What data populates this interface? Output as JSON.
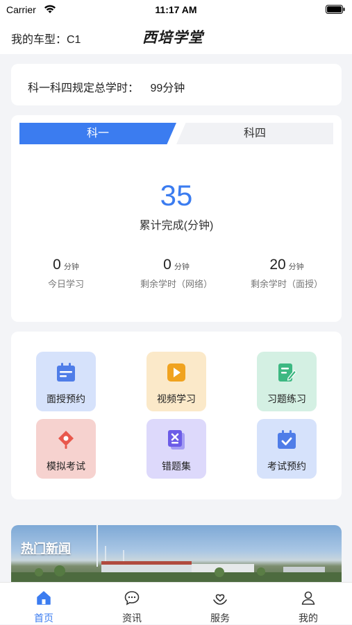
{
  "status_bar": {
    "carrier": "Carrier",
    "time": "11:17 AM"
  },
  "header": {
    "car_type": "我的车型：C1",
    "brand": "西培学堂"
  },
  "required_hours": {
    "label": "科一科四规定总学时：",
    "value": "99分钟"
  },
  "progress": {
    "tabs": [
      {
        "label": "科一",
        "active": true
      },
      {
        "label": "科四",
        "active": false
      }
    ],
    "total_value": "35",
    "total_caption": "累计完成(分钟)",
    "stats": [
      {
        "value": "0",
        "unit": "分钟",
        "label": "今日学习"
      },
      {
        "value": "0",
        "unit": "分钟",
        "label": "剩余学时（网络）"
      },
      {
        "value": "20",
        "unit": "分钟",
        "label": "剩余学时（面授）"
      }
    ]
  },
  "features": [
    {
      "label": "面授预约",
      "icon": "calendar-icon",
      "bg": "#d6e2fb",
      "color": "#4f7de8"
    },
    {
      "label": "视频学习",
      "icon": "play-icon",
      "bg": "#fbe9c9",
      "color": "#f0a320"
    },
    {
      "label": "习题练习",
      "icon": "exercise-icon",
      "bg": "#d4f0e3",
      "color": "#3db882"
    },
    {
      "label": "模拟考试",
      "icon": "pen-icon",
      "bg": "#f6d2cf",
      "color": "#e8584c"
    },
    {
      "label": "错题集",
      "icon": "wrong-book-icon",
      "bg": "#ddd9fb",
      "color": "#6c5ce7"
    },
    {
      "label": "考试预约",
      "icon": "exam-calendar-icon",
      "bg": "#d6e2fb",
      "color": "#4f7de8"
    }
  ],
  "news": {
    "title": "热门新闻"
  },
  "tab_bar": [
    {
      "label": "首页",
      "icon": "home-icon",
      "active": true
    },
    {
      "label": "资讯",
      "icon": "chat-icon",
      "active": false
    },
    {
      "label": "服务",
      "icon": "heart-hand-icon",
      "active": false
    },
    {
      "label": "我的",
      "icon": "user-icon",
      "active": false
    }
  ],
  "colors": {
    "accent": "#3b7cf0",
    "background": "#f3f4f7"
  }
}
